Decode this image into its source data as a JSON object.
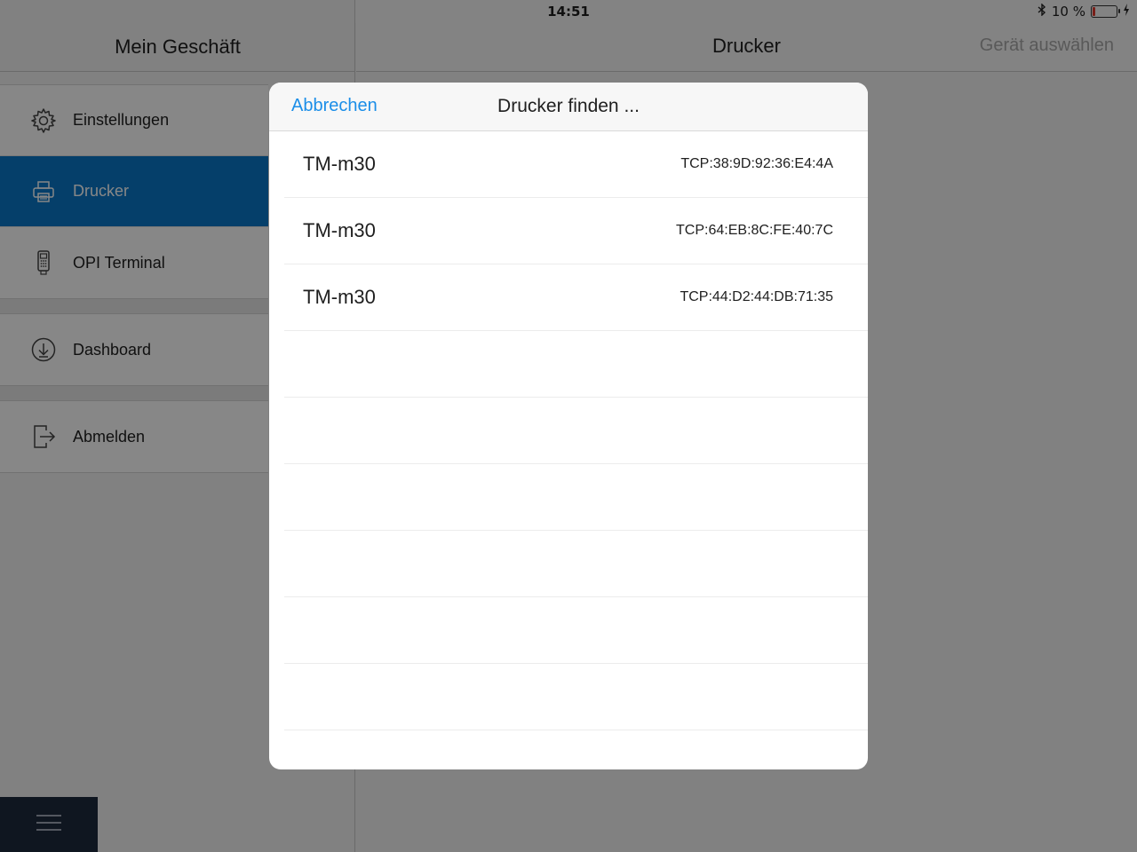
{
  "statusbar": {
    "device": "iPad",
    "time": "14:51",
    "battery_text": "10 %",
    "battery_level": 0.1
  },
  "master": {
    "title": "Mein Geschäft",
    "groups": [
      [
        {
          "label": "Einstellungen",
          "icon": "gear-icon",
          "active": false
        },
        {
          "label": "Drucker",
          "icon": "printer-icon",
          "active": true
        },
        {
          "label": "OPI Terminal",
          "icon": "card-terminal-icon",
          "active": false
        }
      ],
      [
        {
          "label": "Dashboard",
          "icon": "download-circle-icon",
          "active": false
        }
      ],
      [
        {
          "label": "Abmelden",
          "icon": "logout-icon",
          "active": false
        }
      ]
    ]
  },
  "detail": {
    "title": "Drucker",
    "right_action": "Gerät auswählen"
  },
  "modal": {
    "cancel_label": "Abbrechen",
    "title": "Drucker finden ...",
    "devices": [
      {
        "name": "TM-m30",
        "address": "TCP:38:9D:92:36:E4:4A"
      },
      {
        "name": "TM-m30",
        "address": "TCP:64:EB:8C:FE:40:7C"
      },
      {
        "name": "TM-m30",
        "address": "TCP:44:D2:44:DB:71:35"
      }
    ],
    "empty_rows": 6
  },
  "colors": {
    "accent": "#1b8ee8",
    "active_menu": "#0a78c8",
    "hamburger_bg": "#1d2a3d",
    "battery_low": "#e43a2f"
  }
}
